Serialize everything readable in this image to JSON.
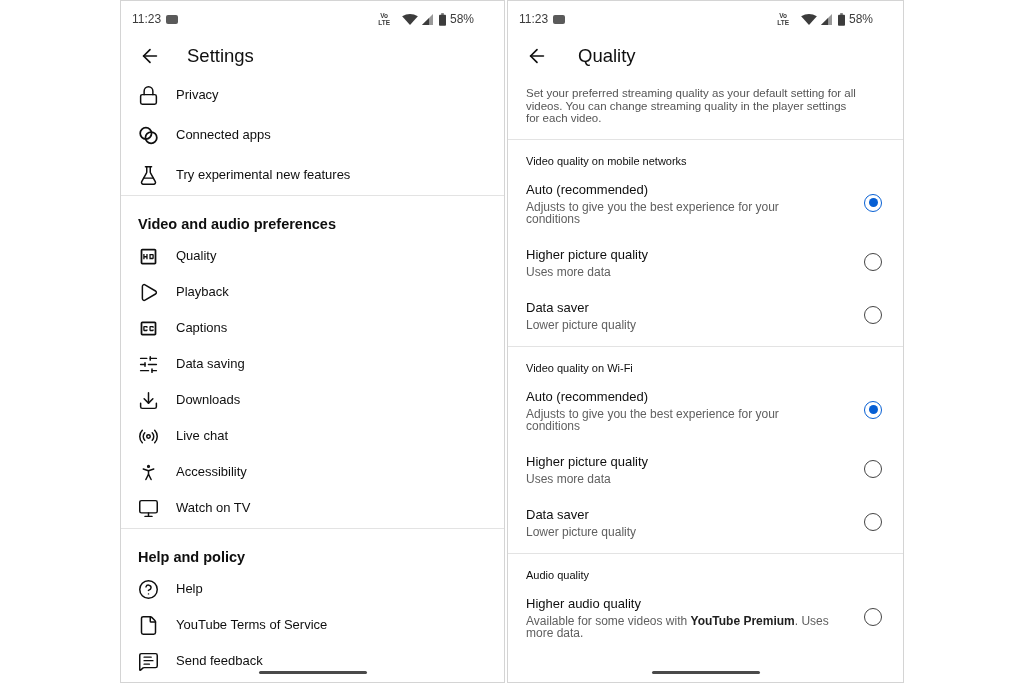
{
  "screens": [
    {
      "kind": "settings",
      "status_bar": {
        "time": "11:23",
        "network": "Vo LTE",
        "battery": "58%"
      },
      "title": "Settings",
      "groups": [
        {
          "items": [
            {
              "label": "Privacy"
            },
            {
              "label": "Connected apps"
            },
            {
              "label": "Try experimental new features"
            }
          ]
        },
        {
          "heading": "Video and audio preferences",
          "items": [
            {
              "label": "Quality"
            },
            {
              "label": "Playback"
            },
            {
              "label": "Captions"
            },
            {
              "label": "Data saving"
            },
            {
              "label": "Downloads"
            },
            {
              "label": "Live chat"
            },
            {
              "label": "Accessibility"
            },
            {
              "label": "Watch on TV"
            }
          ]
        },
        {
          "heading": "Help and policy",
          "items": [
            {
              "label": "Help"
            },
            {
              "label": "YouTube Terms of Service"
            },
            {
              "label": "Send feedback"
            }
          ]
        }
      ]
    },
    {
      "kind": "quality",
      "status_bar": {
        "time": "11:23",
        "network": "Vo LTE",
        "battery": "58%"
      },
      "title": "Quality",
      "description": "Set your preferred streaming quality as your default setting for all videos. You can change streaming quality in the player settings for each video.",
      "sections": [
        {
          "heading": "Video quality on mobile networks",
          "options": [
            {
              "title": "Auto (recommended)",
              "subtitle": "Adjusts to give you the best experience for your conditions",
              "selected": true
            },
            {
              "title": "Higher picture quality",
              "subtitle": "Uses more data",
              "selected": false
            },
            {
              "title": "Data saver",
              "subtitle": "Lower picture quality",
              "selected": false
            }
          ]
        },
        {
          "heading": "Video quality on Wi-Fi",
          "options": [
            {
              "title": "Auto (recommended)",
              "subtitle": "Adjusts to give you the best experience for your conditions",
              "selected": true
            },
            {
              "title": "Higher picture quality",
              "subtitle": "Uses more data",
              "selected": false
            },
            {
              "title": "Data saver",
              "subtitle": "Lower picture quality",
              "selected": false
            }
          ]
        },
        {
          "heading": "Audio quality",
          "options": [
            {
              "title": "Higher audio quality",
              "subtitle": "Available for some videos with **YouTube Premium**. Uses more data.",
              "selected": false
            }
          ]
        }
      ]
    }
  ]
}
